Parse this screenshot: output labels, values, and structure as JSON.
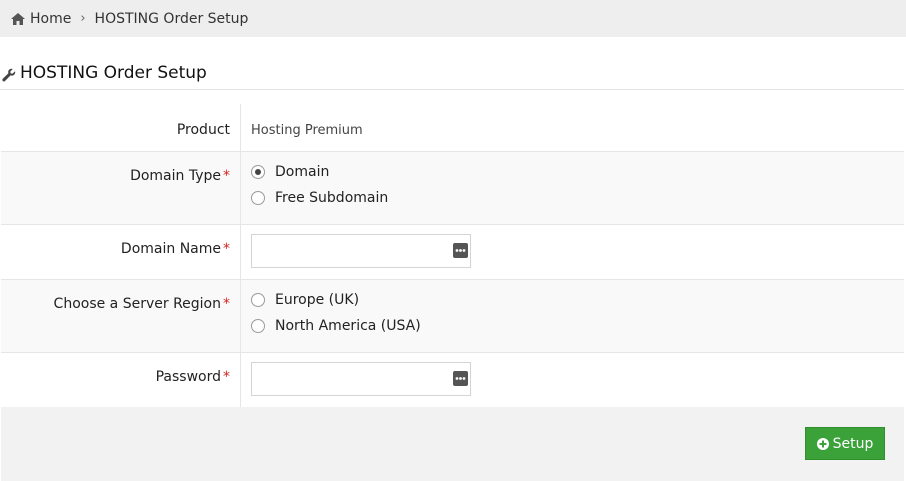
{
  "breadcrumb": {
    "home": "Home",
    "current": "HOSTING Order Setup"
  },
  "page": {
    "title": "HOSTING Order Setup"
  },
  "form": {
    "product": {
      "label": "Product",
      "value": "Hosting Premium"
    },
    "domain_type": {
      "label": "Domain Type",
      "options": [
        {
          "label": "Domain",
          "selected": true
        },
        {
          "label": "Free Subdomain",
          "selected": false
        }
      ]
    },
    "domain_name": {
      "label": "Domain Name",
      "value": ""
    },
    "server_region": {
      "label": "Choose a Server Region",
      "options": [
        {
          "label": "Europe (UK)",
          "selected": false
        },
        {
          "label": "North America (USA)",
          "selected": false
        }
      ]
    },
    "password": {
      "label": "Password",
      "value": ""
    },
    "required_mark": "*"
  },
  "actions": {
    "setup_label": "Setup"
  },
  "icons": [
    "home-icon",
    "chevron-right-icon",
    "wrench-icon",
    "password-dots-icon",
    "plus-circle-icon"
  ],
  "colors": {
    "accent": "#3ba23a",
    "required": "#d9231d",
    "breadcrumb_bg": "#eeeeee"
  }
}
